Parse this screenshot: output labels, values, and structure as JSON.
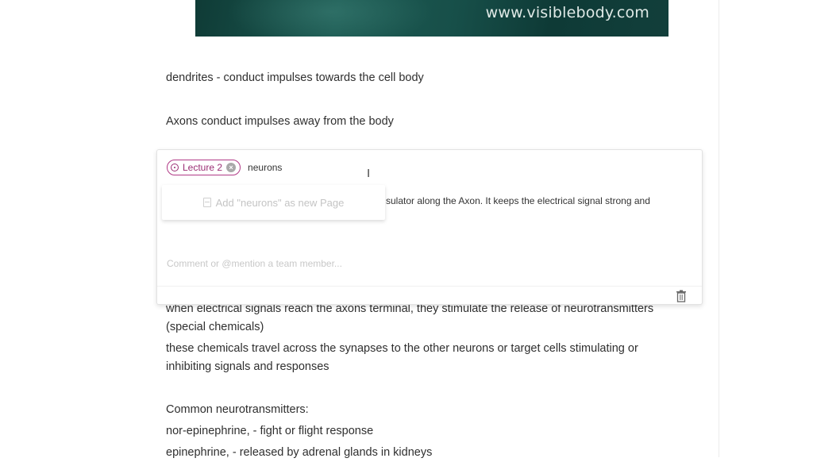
{
  "banner": {
    "url": "www.visiblebody.com"
  },
  "notes": {
    "line1": "dendrites - conduct impulses towards the cell body",
    "line2": "Axons conduct impulses away from the body",
    "line3": "when electrical signals reach the axons terminal, they stimulate the release of neurotransmitters",
    "line4": "(special chemicals)",
    "line5": "these chemicals travel across the synapses to the other neurons or target cells stimulating or",
    "line6": "inhibiting signals and responses",
    "line7": "Common neurotransmitters:",
    "line8": "nor-epinephrine, - fight or flight response",
    "line9": "epinephrine, - released by adrenal glands in kidneys"
  },
  "popup": {
    "tag": {
      "label": "Lecture 2"
    },
    "tag_input_value": "neurons",
    "suggestion": "Add \"neurons\" as new Page",
    "behind_text": "sulator along the Axon. It keeps the electrical signal strong and",
    "comment_placeholder": "Comment or @mention a team member...",
    "colors": {
      "tag": "#b13a86"
    }
  }
}
